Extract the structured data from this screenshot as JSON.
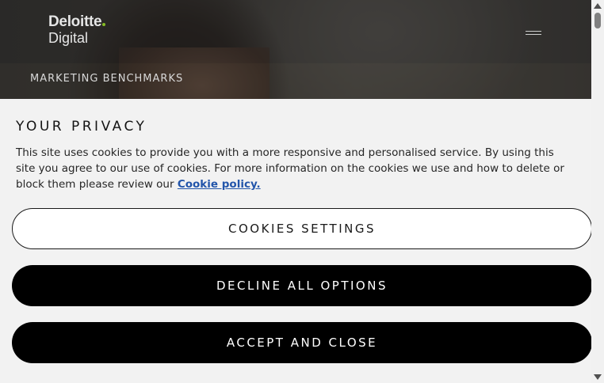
{
  "colors": {
    "brand_dot": "#86bc25",
    "link": "#2255aa",
    "button_dark": "#000000",
    "banner_bg": "#f2f2f2"
  },
  "header": {
    "logo": {
      "line1": "Deloitte",
      "line2": "Digital"
    },
    "menu_icon": "hamburger-menu-icon"
  },
  "breadcrumb": {
    "label": "MARKETING BENCHMARKS"
  },
  "privacy_banner": {
    "title": "YOUR PRIVACY",
    "body": "This site uses cookies to provide you with a more responsive and personalised service. By using this site you agree to our use of cookies. For more information on the cookies we use and how to delete or block them please review our",
    "link_label": "Cookie policy.",
    "buttons": {
      "settings": "COOKIES SETTINGS",
      "decline": "DECLINE ALL OPTIONS",
      "accept": "ACCEPT AND CLOSE"
    }
  },
  "scrollbar": {
    "up_icon": "scroll-up-arrow-icon",
    "down_icon": "scroll-down-arrow-icon"
  }
}
